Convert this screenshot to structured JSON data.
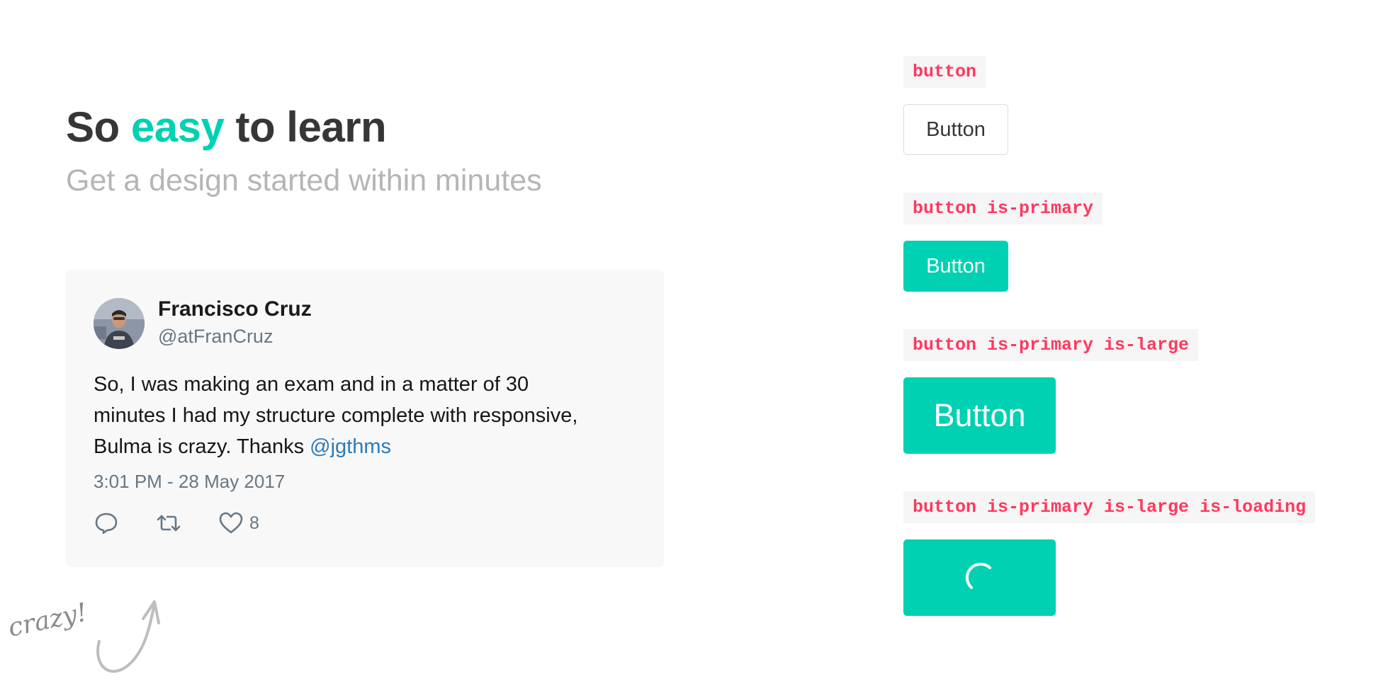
{
  "hero": {
    "title_prefix": "So",
    "title_accent": "easy",
    "title_suffix": "to learn",
    "subtitle": "Get a design started within minutes"
  },
  "tweet": {
    "name": "Francisco Cruz",
    "handle": "@atFranCruz",
    "body_line1": "So, I was making an exam and in a matter of 30",
    "body_line2": "minutes I had my structure complete with responsive,",
    "body_line3": "Bulma is crazy. Thanks",
    "mention": "@jgthms",
    "timestamp": "3:01 PM - 28 May 2017",
    "like_count": "8",
    "icons": [
      "reply-icon",
      "retweet-icon",
      "heart-icon"
    ]
  },
  "annotation": {
    "text": "crazy!"
  },
  "demos": [
    {
      "code": "button",
      "label": "Button"
    },
    {
      "code": "button is-primary",
      "label": "Button"
    },
    {
      "code": "button is-primary is-large",
      "label": "Button"
    },
    {
      "code": "button is-primary is-large is-loading",
      "label": ""
    }
  ],
  "colors": {
    "primary": "#00d1b2",
    "code_text": "#ff3860",
    "code_bg": "#f5f5f5",
    "mention": "#2b7bb9",
    "title": "#363636",
    "subtitle": "#b5b5b5"
  }
}
